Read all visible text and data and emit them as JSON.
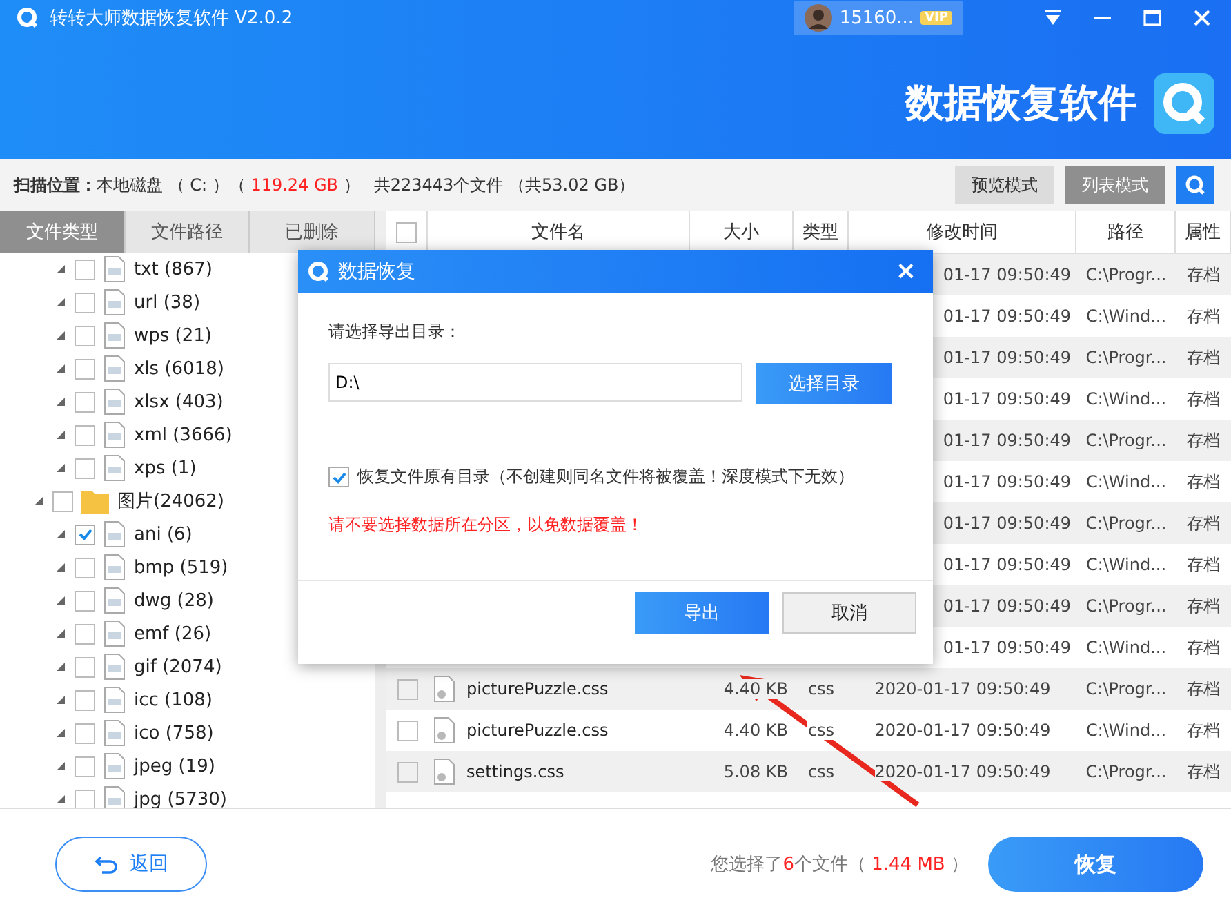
{
  "window": {
    "title": "转转大师数据恢复软件 V2.0.2",
    "user": "15160...",
    "badge": "VIP"
  },
  "banner": {
    "title": "数据恢复软件"
  },
  "scan": {
    "label": "扫描位置：",
    "disk": "本地磁盘 （ C: ）（ ",
    "size": "119.24 GB",
    "after": " ）",
    "total": "共223443个文件 （共53.02 GB）"
  },
  "modes": [
    {
      "label": "预览模式",
      "selected": false
    },
    {
      "label": "列表模式",
      "selected": true
    }
  ],
  "tabs": [
    {
      "label": "文件类型",
      "selected": true
    },
    {
      "label": "文件路径",
      "selected": false
    },
    {
      "label": "已删除",
      "selected": false
    }
  ],
  "tree": [
    {
      "children": [
        {
          "label": "txt (867)",
          "checked": false
        },
        {
          "label": "url (38)",
          "checked": false
        },
        {
          "label": "wps (21)",
          "checked": false
        },
        {
          "label": "xls (6018)",
          "checked": false
        },
        {
          "label": "xlsx (403)",
          "checked": false
        },
        {
          "label": "xml (3666)",
          "checked": false
        },
        {
          "label": "xps (1)",
          "checked": false
        }
      ]
    },
    {
      "label": "图片(24062)",
      "checked": false,
      "children": [
        {
          "label": "ani (6)",
          "checked": true
        },
        {
          "label": "bmp (519)",
          "checked": false
        },
        {
          "label": "dwg (28)",
          "checked": false
        },
        {
          "label": "emf (26)",
          "checked": false
        },
        {
          "label": "gif (2074)",
          "checked": false
        },
        {
          "label": "icc (108)",
          "checked": false
        },
        {
          "label": "ico (758)",
          "checked": false
        },
        {
          "label": "jpeg (19)",
          "checked": false
        },
        {
          "label": "jpg (5730)",
          "checked": false
        }
      ]
    }
  ],
  "table": {
    "select_all_checked": false,
    "columns": [
      "文件名",
      "大小",
      "类型",
      "修改时间",
      "路径",
      "属性"
    ],
    "rows": [
      {
        "kind": "partial",
        "time": "01-17 09:50:49",
        "path": "C:\\Progr...",
        "attr": "存档"
      },
      {
        "kind": "partial",
        "time": "01-17 09:50:49",
        "path": "C:\\Wind...",
        "attr": "存档"
      },
      {
        "kind": "partial",
        "time": "01-17 09:50:49",
        "path": "C:\\Progr...",
        "attr": "存档"
      },
      {
        "kind": "partial",
        "time": "01-17 09:50:49",
        "path": "C:\\Wind...",
        "attr": "存档"
      },
      {
        "kind": "partial",
        "time": "01-17 09:50:49",
        "path": "C:\\Progr...",
        "attr": "存档"
      },
      {
        "kind": "partial",
        "time": "01-17 09:50:49",
        "path": "C:\\Wind...",
        "attr": "存档"
      },
      {
        "kind": "partial",
        "time": "01-17 09:50:49",
        "path": "C:\\Progr...",
        "attr": "存档"
      },
      {
        "kind": "partial",
        "time": "01-17 09:50:49",
        "path": "C:\\Wind...",
        "attr": "存档"
      },
      {
        "kind": "partial",
        "time": "01-17 09:50:49",
        "path": "C:\\Progr...",
        "attr": "存档"
      },
      {
        "kind": "partial",
        "time": "01-17 09:50:49",
        "path": "C:\\Wind...",
        "attr": "存档"
      },
      {
        "kind": "full",
        "checked": false,
        "name": "picturePuzzle.css",
        "size": "4.40 KB",
        "type": "css",
        "time": "2020-01-17 09:50:49",
        "path": "C:\\Progr...",
        "attr": "存档"
      },
      {
        "kind": "full",
        "checked": false,
        "name": "picturePuzzle.css",
        "size": "4.40 KB",
        "type": "css",
        "time": "2020-01-17 09:50:49",
        "path": "C:\\Wind...",
        "attr": "存档"
      },
      {
        "kind": "full",
        "checked": false,
        "name": "settings.css",
        "size": "5.08 KB",
        "type": "css",
        "time": "2020-01-17 09:50:49",
        "path": "C:\\Progr...",
        "attr": "存档"
      }
    ]
  },
  "footer": {
    "back": "返回",
    "prefix": "您选择了",
    "count": "6",
    "mid": "个文件（ ",
    "size": "1.44 MB",
    "suffix": " ）",
    "recover": "恢复"
  },
  "dialog": {
    "title": "数据恢复",
    "close": "×",
    "prompt": "请选择导出目录：",
    "path": "D:\\",
    "browse": "选择目录",
    "keep_dirs": {
      "label": "恢复文件原有目录（不创建则同名文件将被覆盖！深度模式下无效）",
      "checked": true
    },
    "warning": "请不要选择数据所在分区，以免数据覆盖！",
    "ok": "导出",
    "cancel": "取消"
  }
}
